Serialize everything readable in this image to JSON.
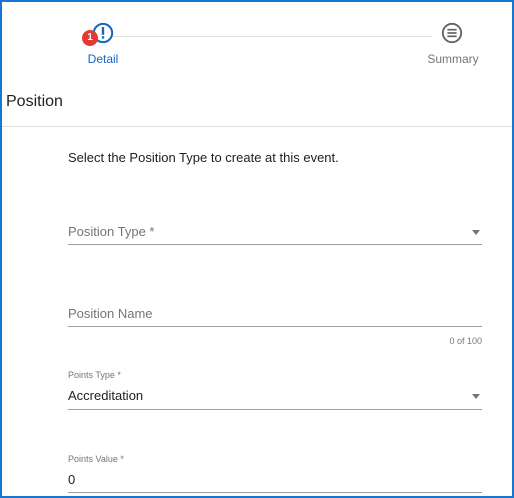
{
  "stepper": {
    "steps": [
      {
        "label": "Detail",
        "badge": "1",
        "icon": "alert-circle-icon",
        "status": "active",
        "color": "#1565c0"
      },
      {
        "label": "Summary",
        "icon": "list-circle-icon",
        "status": "inactive",
        "color": "#757575"
      }
    ]
  },
  "section": {
    "title": "Position",
    "instruction": "Select the Position Type to create at this event."
  },
  "form": {
    "position_type": {
      "placeholder": "Position Type *",
      "value": ""
    },
    "position_name": {
      "placeholder": "Position Name",
      "value": "",
      "counter": "0 of 100"
    },
    "points_type": {
      "label": "Points Type *",
      "value": "Accreditation"
    },
    "points_value": {
      "label": "Points Value *",
      "value": "0"
    }
  },
  "colors": {
    "accent": "#1565c0",
    "badge": "#e53935",
    "border": "#1976d2"
  }
}
